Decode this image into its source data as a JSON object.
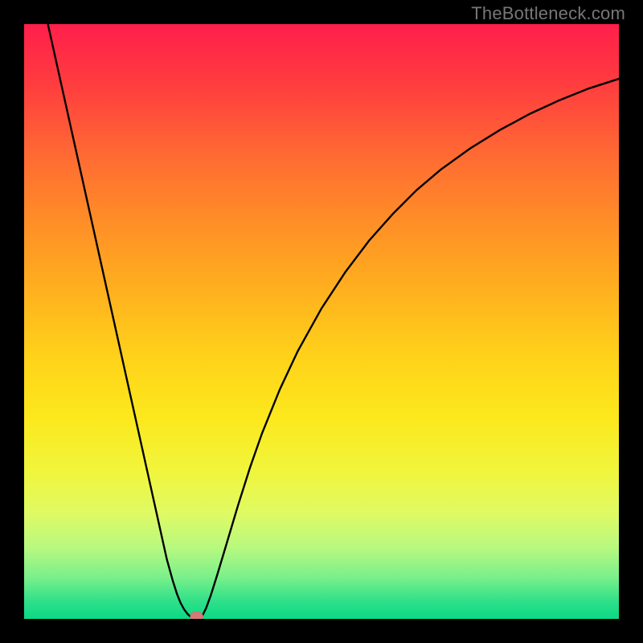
{
  "watermark": "TheBottleneck.com",
  "chart_data": {
    "type": "line",
    "title": "",
    "xlabel": "",
    "ylabel": "",
    "xlim": [
      0,
      100
    ],
    "ylim": [
      0,
      100
    ],
    "grid": false,
    "legend": false,
    "annotations": [],
    "curve_points": [
      {
        "x": 4.0,
        "y": 100.0
      },
      {
        "x": 6.0,
        "y": 91.0
      },
      {
        "x": 8.0,
        "y": 82.0
      },
      {
        "x": 10.0,
        "y": 73.0
      },
      {
        "x": 12.0,
        "y": 64.0
      },
      {
        "x": 14.0,
        "y": 55.0
      },
      {
        "x": 16.0,
        "y": 46.0
      },
      {
        "x": 18.0,
        "y": 37.0
      },
      {
        "x": 20.0,
        "y": 28.0
      },
      {
        "x": 22.0,
        "y": 19.0
      },
      {
        "x": 23.0,
        "y": 14.5
      },
      {
        "x": 24.0,
        "y": 10.0
      },
      {
        "x": 25.0,
        "y": 6.4
      },
      {
        "x": 25.7,
        "y": 4.2
      },
      {
        "x": 26.3,
        "y": 2.7
      },
      {
        "x": 26.9,
        "y": 1.6
      },
      {
        "x": 27.5,
        "y": 0.8
      },
      {
        "x": 28.0,
        "y": 0.35
      },
      {
        "x": 28.5,
        "y": 0.08
      },
      {
        "x": 29.0,
        "y": 0.0
      },
      {
        "x": 29.5,
        "y": 0.12
      },
      {
        "x": 30.0,
        "y": 0.6
      },
      {
        "x": 30.6,
        "y": 1.8
      },
      {
        "x": 31.4,
        "y": 4.0
      },
      {
        "x": 32.5,
        "y": 7.5
      },
      {
        "x": 34.0,
        "y": 12.5
      },
      {
        "x": 36.0,
        "y": 19.2
      },
      {
        "x": 38.0,
        "y": 25.5
      },
      {
        "x": 40.0,
        "y": 31.2
      },
      {
        "x": 43.0,
        "y": 38.6
      },
      {
        "x": 46.0,
        "y": 45.0
      },
      {
        "x": 50.0,
        "y": 52.2
      },
      {
        "x": 54.0,
        "y": 58.3
      },
      {
        "x": 58.0,
        "y": 63.6
      },
      {
        "x": 62.0,
        "y": 68.1
      },
      {
        "x": 66.0,
        "y": 72.1
      },
      {
        "x": 70.0,
        "y": 75.5
      },
      {
        "x": 75.0,
        "y": 79.1
      },
      {
        "x": 80.0,
        "y": 82.2
      },
      {
        "x": 85.0,
        "y": 84.9
      },
      {
        "x": 90.0,
        "y": 87.2
      },
      {
        "x": 95.0,
        "y": 89.2
      },
      {
        "x": 100.0,
        "y": 90.8
      }
    ],
    "highlight_point": {
      "x": 29.0,
      "y": 0.0
    },
    "background_gradient": {
      "top": "#ff1f4b",
      "mid": "#ffd21a",
      "bottom": "#0bd985"
    }
  }
}
